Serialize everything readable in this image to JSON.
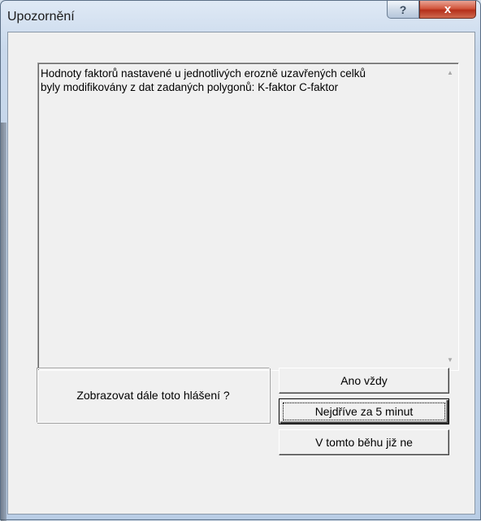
{
  "window": {
    "title": "Upozornění",
    "help_glyph": "?",
    "close_glyph": "x"
  },
  "message": {
    "text": "Hodnoty faktorů nastavené u jednotlivých erozně uzavřených celků\nbyly modifikovány z dat zadaných polygonů: K-faktor   C-faktor"
  },
  "prompt": {
    "label": "Zobrazovat dále toto hlášení ?"
  },
  "buttons": {
    "always": "Ano vždy",
    "later": "Nejdříve za 5 minut",
    "not_this_run": "V tomto běhu již ne"
  },
  "colors": {
    "close_red": "#c8452c",
    "dialog_face": "#f0f0f0",
    "frame": "#c9d9ec"
  }
}
